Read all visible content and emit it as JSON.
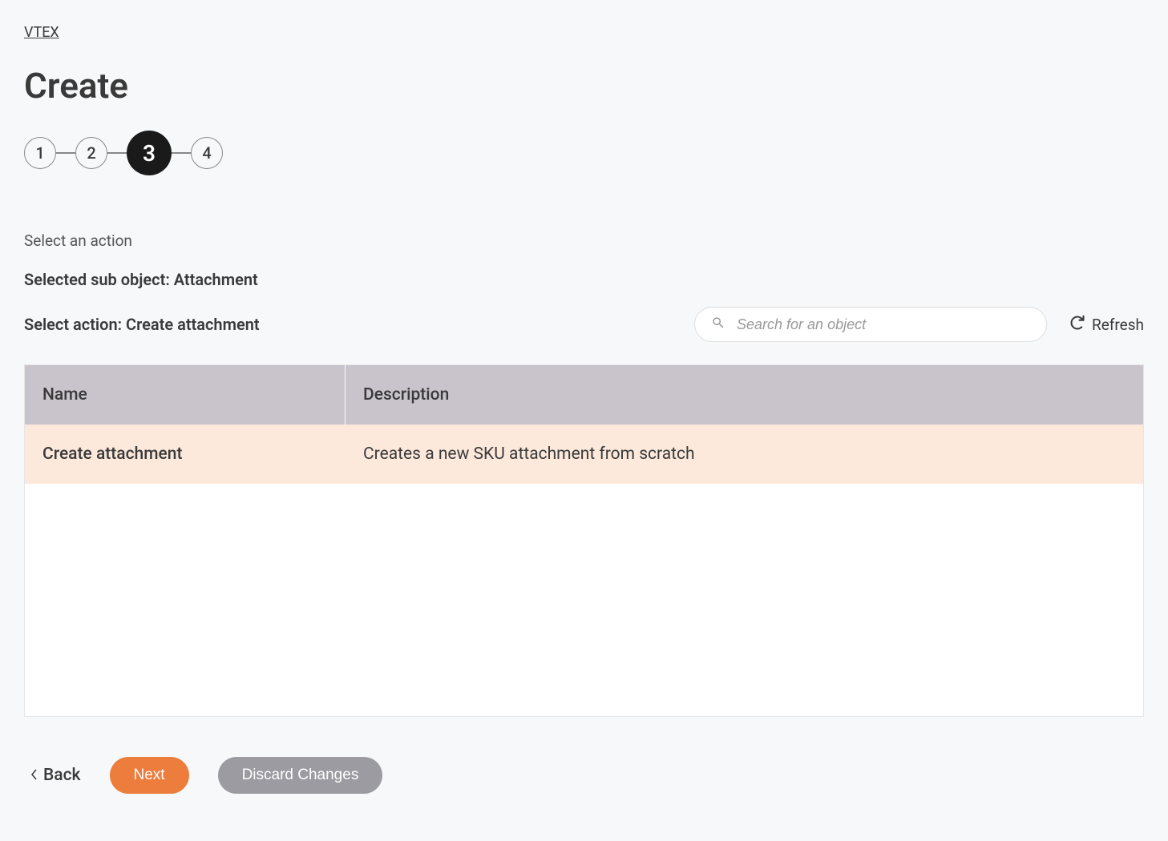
{
  "breadcrumb": {
    "label": "VTEX"
  },
  "page": {
    "title": "Create"
  },
  "stepper": {
    "steps": [
      "1",
      "2",
      "3",
      "4"
    ],
    "active_index": 2
  },
  "section": {
    "label": "Select an action",
    "selected_sub_object_line": "Selected sub object: Attachment",
    "select_action_line": "Select action: Create attachment"
  },
  "search": {
    "placeholder": "Search for an object"
  },
  "refresh": {
    "label": "Refresh"
  },
  "table": {
    "headers": {
      "name": "Name",
      "description": "Description"
    },
    "rows": [
      {
        "name": "Create attachment",
        "description": "Creates a new SKU attachment from scratch",
        "selected": true
      }
    ]
  },
  "footer": {
    "back_label": "Back",
    "next_label": "Next",
    "discard_label": "Discard Changes"
  }
}
